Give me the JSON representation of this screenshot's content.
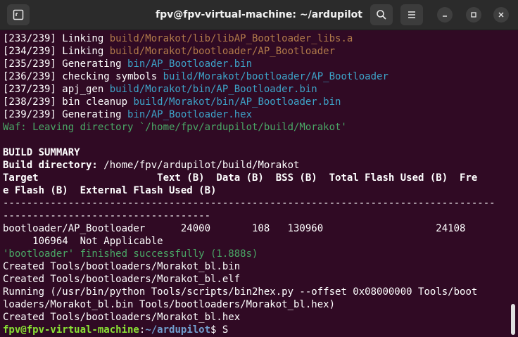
{
  "window": {
    "title": "fpv@fpv-virtual-machine: ~/ardupilot",
    "new_tab_icon": "new-tab-icon",
    "search_icon": "search-icon",
    "menu_icon": "hamburger-menu-icon",
    "minimize_icon": "minimize-icon",
    "maximize_icon": "maximize-icon",
    "close_icon": "close-icon"
  },
  "terminal": {
    "l1": {
      "a": "[233/239] Linking ",
      "b": "build/Morakot/lib/libAP_Bootloader_libs.a"
    },
    "l2": {
      "a": "[234/239] Linking ",
      "b": "build/Morakot/bootloader/AP_Bootloader"
    },
    "l3": {
      "a": "[235/239] Generating ",
      "b": "bin/AP_Bootloader.bin"
    },
    "l4": {
      "a": "[236/239] checking symbols ",
      "b": "build/Morakot/bootloader/AP_Bootloader"
    },
    "l5": {
      "a": "[237/239] apj_gen ",
      "b": "build/Morakot/bin/AP_Bootloader.bin"
    },
    "l6": {
      "a": "[238/239] bin cleanup ",
      "b": "build/Morakot/bin/AP_Bootloader.bin"
    },
    "l7": {
      "a": "[239/239] Generating ",
      "b": "bin/AP_Bootloader.hex"
    },
    "l8": "Waf: Leaving directory `/home/fpv/ardupilot/build/Morakot'",
    "l10": "BUILD SUMMARY",
    "l11": {
      "a": "Build directory: ",
      "b": "/home/fpv/ardupilot/build/Morakot"
    },
    "l12": "Target                    Text (B)  Data (B)  BSS (B)  Total Flash Used (B)  Fre",
    "l13": "e Flash (B)  External Flash Used (B)",
    "l14": "-----------------------------------------------------------------------------------",
    "l15": "-----------------------------------",
    "l16": "bootloader/AP_Bootloader      24000       108   130960                   24108",
    "l17": "     106964  Not Applicable",
    "l18": "'bootloader' finished successfully (1.888s)",
    "l19": "Created Tools/bootloaders/Morakot_bl.bin",
    "l20": "Created Tools/bootloaders/Morakot_bl.elf",
    "l21": "Running (/usr/bin/python Tools/scripts/bin2hex.py --offset 0x08000000 Tools/boot",
    "l22": "loaders/Morakot_bl.bin Tools/bootloaders/Morakot_bl.hex)",
    "l23": "Created Tools/bootloaders/Morakot_bl.hex",
    "prompt": {
      "user": "fpv@fpv-virtual-machine",
      "sep": ":",
      "path": "~/ardupilot",
      "dollar": "$ ",
      "input": "S"
    }
  }
}
